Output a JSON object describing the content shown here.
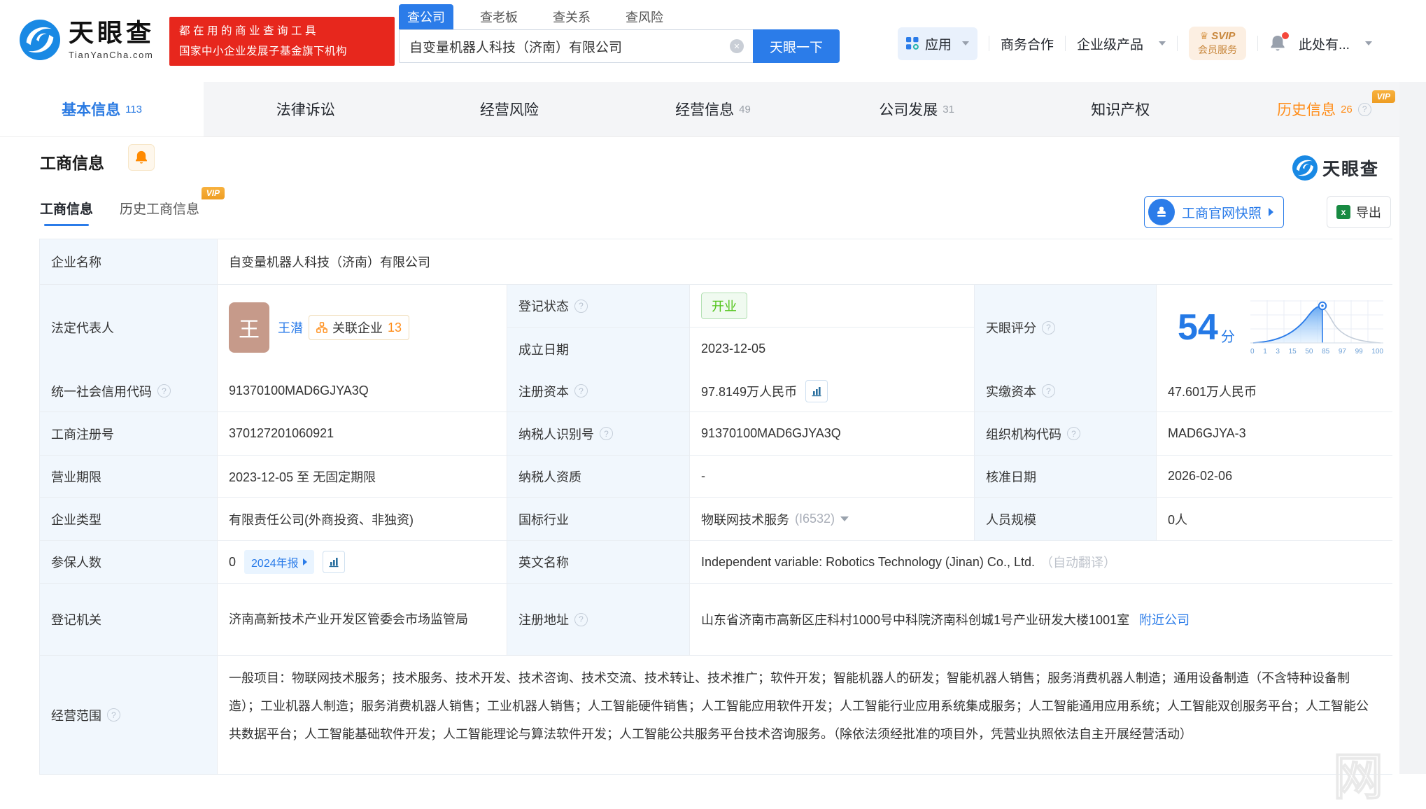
{
  "misc": {
    "vip": "VIP",
    "watermark_char": "网"
  },
  "colors": {
    "brand_blue": "#2b7ce9",
    "slogan_red": "#e7271d",
    "vip_orange": "#f2a33a",
    "status_green": "#52c41a",
    "score_blue": "#2479e6",
    "label_bg": "#f1f7fd"
  },
  "header": {
    "logo": {
      "title": "天眼查",
      "subtitle": "TianYanCha.com"
    },
    "slogan_badge": {
      "line1": "都在用的商业查询工具",
      "line2": "国家中小企业发展子基金旗下机构"
    },
    "search": {
      "tabs": [
        {
          "label": "查公司"
        },
        {
          "label": "查老板"
        },
        {
          "label": "查关系"
        },
        {
          "label": "查风险"
        }
      ],
      "input_value": "自变量机器人科技（济南）有限公司",
      "button_label": "天眼一下"
    },
    "nav": {
      "apps": "应用",
      "business_coop": "商务合作",
      "enterprise_products": "企业级产品",
      "svip_line1": "SVIP",
      "svip_line2": "会员服务",
      "user_menu": "此处有..."
    }
  },
  "tabbar": {
    "tabs": [
      {
        "label": "基本信息",
        "count": "113"
      },
      {
        "label": "法律诉讼",
        "count": ""
      },
      {
        "label": "经营风险",
        "count": ""
      },
      {
        "label": "经营信息",
        "count": "49"
      },
      {
        "label": "公司发展",
        "count": "31"
      },
      {
        "label": "知识产权",
        "count": ""
      },
      {
        "label": "历史信息",
        "count": "26"
      }
    ]
  },
  "section": {
    "title": "工商信息",
    "watermark_logo": "天眼查",
    "subtabs": [
      {
        "label": "工商信息"
      },
      {
        "label": "历史工商信息"
      }
    ],
    "snapshot_button": "工商官网快照",
    "export_button": "导出"
  },
  "table": {
    "company_name_label": "企业名称",
    "company_name": "自变量机器人科技（济南）有限公司",
    "legal_rep_label": "法定代表人",
    "legal_rep": {
      "avatar_char": "王",
      "name": "王潜",
      "relation_label": "关联企业",
      "relation_count": "13"
    },
    "reg_status_label": "登记状态",
    "reg_status": "开业",
    "establish_date_label": "成立日期",
    "establish_date": "2023-12-05",
    "tyc_score_label": "天眼评分",
    "credit_code_label": "统一社会信用代码",
    "credit_code": "91370100MAD6GJYA3Q",
    "reg_capital_label": "注册资本",
    "reg_capital": "97.8149万人民币",
    "paid_capital_label": "实缴资本",
    "paid_capital": "47.601万人民币",
    "reg_number_label": "工商注册号",
    "reg_number": "370127201060921",
    "taxpayer_id_label": "纳税人识别号",
    "taxpayer_id": "91370100MAD6GJYA3Q",
    "org_code_label": "组织机构代码",
    "org_code": "MAD6GJYA-3",
    "business_term_label": "营业期限",
    "business_term": "2023-12-05 至 无固定期限",
    "taxpayer_quality_label": "纳税人资质",
    "taxpayer_quality": "-",
    "approval_date_label": "核准日期",
    "approval_date": "2026-02-06",
    "company_type_label": "企业类型",
    "company_type": "有限责任公司(外商投资、非独资)",
    "industry_label": "国标行业",
    "industry": "物联网技术服务",
    "industry_code": "(I6532)",
    "staff_size_label": "人员规模",
    "staff_size": "0人",
    "insured_label": "参保人数",
    "insured": "0",
    "annual_report_badge": "2024年报",
    "english_name_label": "英文名称",
    "english_name": "Independent variable: Robotics Technology (Jinan) Co., Ltd.",
    "english_name_note": "（自动翻译）",
    "reg_authority_label": "登记机关",
    "reg_authority": "济南高新技术产业开发区管委会市场监管局",
    "address_label": "注册地址",
    "address": "山东省济南市高新区庄科村1000号中科院济南科创城1号产业研发大楼1001室",
    "nearby_link": "附近公司",
    "scope_label": "经营范围",
    "scope": "一般项目：物联网技术服务；技术服务、技术开发、技术咨询、技术交流、技术转让、技术推广；软件开发；智能机器人的研发；智能机器人销售；服务消费机器人制造；通用设备制造（不含特种设备制造）；工业机器人制造；服务消费机器人销售；工业机器人销售；人工智能硬件销售；人工智能应用软件开发；人工智能行业应用系统集成服务；人工智能通用应用系统；人工智能双创服务平台；人工智能公共数据平台；人工智能基础软件开发；人工智能理论与算法软件开发；人工智能公共服务平台技术咨询服务。（除依法须经批准的项目外，凭营业执照依法自主开展经营活动）"
  },
  "chart_data": {
    "type": "area",
    "title": "天眼评分分布曲线",
    "score": "54",
    "score_unit": "分",
    "xticks": [
      "0",
      "1",
      "3",
      "15",
      "50",
      "85",
      "97",
      "99",
      "100"
    ],
    "marker_tick": "50",
    "curve_points_norm": [
      [
        0,
        0.03
      ],
      [
        0.15,
        0.08
      ],
      [
        0.3,
        0.22
      ],
      [
        0.4,
        0.55
      ],
      [
        0.5,
        0.95
      ],
      [
        0.54,
        1.0
      ],
      [
        0.62,
        0.72
      ],
      [
        0.72,
        0.35
      ],
      [
        0.85,
        0.1
      ],
      [
        1,
        0.03
      ]
    ],
    "legend": [],
    "xlabel": "",
    "ylabel": ""
  }
}
